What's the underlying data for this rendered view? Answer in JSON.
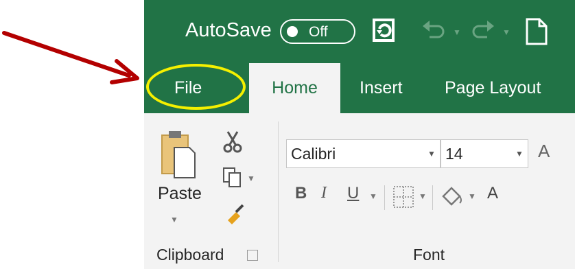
{
  "title_bar": {
    "autosave_label": "AutoSave",
    "autosave_state": "Off",
    "icons": [
      "sync-icon",
      "undo-icon",
      "redo-icon",
      "new-document-icon"
    ]
  },
  "tabs": [
    {
      "label": "File",
      "active": false,
      "highlighted": true
    },
    {
      "label": "Home",
      "active": true
    },
    {
      "label": "Insert",
      "active": false
    },
    {
      "label": "Page Layout",
      "active": false
    }
  ],
  "ribbon": {
    "clipboard": {
      "paste_label": "Paste",
      "group_label": "Clipboard"
    },
    "font": {
      "font_name": "Calibri",
      "font_size": "14",
      "grow_font_label": "A",
      "font_color_label": "A",
      "group_label": "Font"
    }
  },
  "colors": {
    "excel_green": "#217346",
    "ribbon_bg": "#f3f3f3",
    "highlight_yellow": "#f5f000",
    "arrow_red": "#b30000"
  }
}
